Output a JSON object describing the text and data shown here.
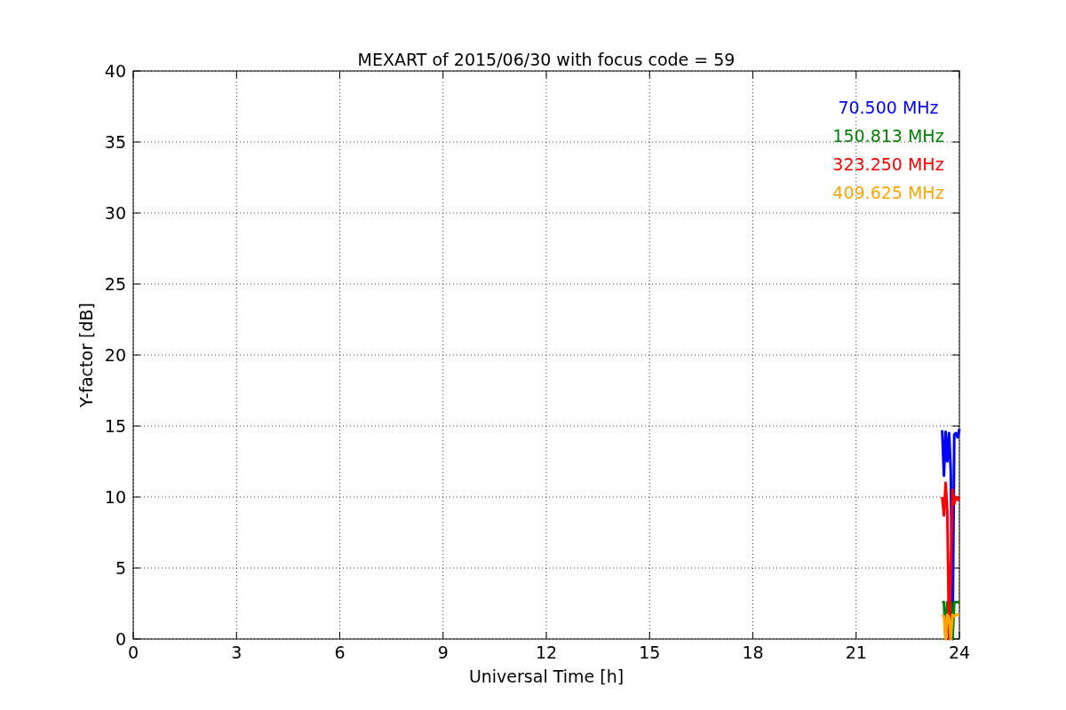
{
  "chart_data": {
    "type": "line",
    "title": "MEXART of 2015/06/30 with focus code = 59",
    "xlabel": "Universal Time [h]",
    "ylabel": "Y-factor [dB]",
    "x": [
      23.5,
      23.55,
      23.6,
      23.65,
      23.7,
      23.75,
      23.8,
      23.85,
      23.9,
      23.95,
      24.0
    ],
    "series": [
      {
        "name": "70.500 MHz",
        "color": "#0000ff",
        "values": [
          14.7,
          11.5,
          14.6,
          12.5,
          14.5,
          11.8,
          0,
          14.4,
          14.5,
          14.2,
          14.8
        ]
      },
      {
        "name": "150.813 MHz",
        "color": "#008000",
        "values": [
          2.6,
          2.6,
          0,
          2.6,
          2.5,
          2.6,
          0,
          2.6,
          2.6,
          2.6,
          2.6
        ]
      },
      {
        "name": "323.250 MHz",
        "color": "#ff0000",
        "values": [
          10,
          8.7,
          11,
          9,
          0,
          5,
          10.5,
          9.5,
          10,
          9.8,
          10
        ]
      },
      {
        "name": "409.625 MHz",
        "color": "#ffa500",
        "values": [
          1.7,
          1.6,
          0,
          1.7,
          1.5,
          0,
          1.7,
          1.6,
          1.7,
          1.7,
          1.7
        ]
      }
    ],
    "xlim": [
      0,
      24
    ],
    "ylim": [
      0,
      40
    ],
    "xticks": [
      0,
      3,
      6,
      9,
      12,
      15,
      18,
      21,
      24
    ],
    "yticks": [
      0,
      5,
      10,
      15,
      20,
      25,
      30,
      35,
      40
    ],
    "grid": true
  }
}
